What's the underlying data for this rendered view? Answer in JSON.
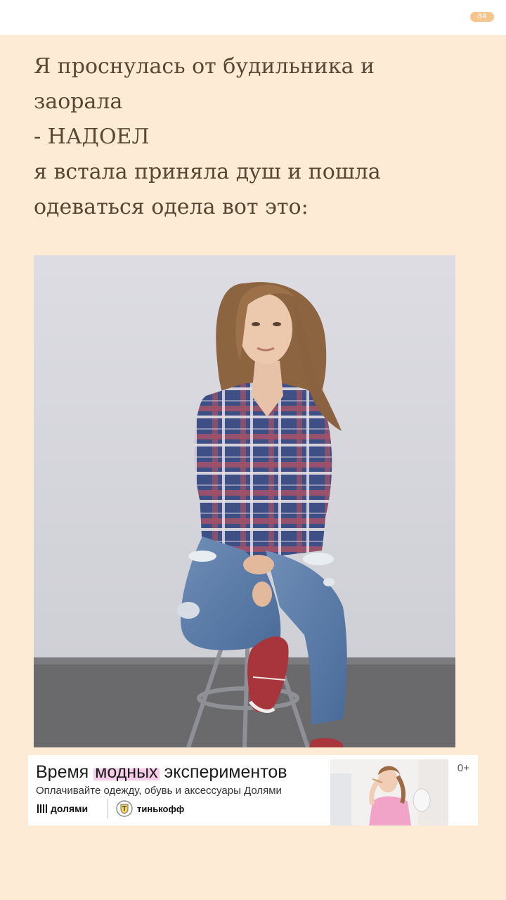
{
  "header": {
    "page_badge": "84"
  },
  "story": {
    "lines": [
      "Я проснулась от будильника и",
      "заорала",
      "- НАДОЕЛ",
      "я встала приняла душ и пошла",
      "одеваться одела вот это:"
    ]
  },
  "photo": {
    "subject": "woman-in-plaid-shirt-and-ripped-jeans"
  },
  "ad": {
    "headline_before": "Время ",
    "headline_highlight": "модных",
    "headline_after": " экспериментов",
    "subtitle": "Оплачивайте одежду, обувь и аксессуары Долями",
    "brand_dolyami": "долями",
    "brand_tinkoff": "тинькофф",
    "age_rating": "0+",
    "highlight_color": "#f7cdea"
  },
  "colors": {
    "background": "#fdebd6",
    "text": "#5a4432",
    "badge": "#f6c58b"
  }
}
